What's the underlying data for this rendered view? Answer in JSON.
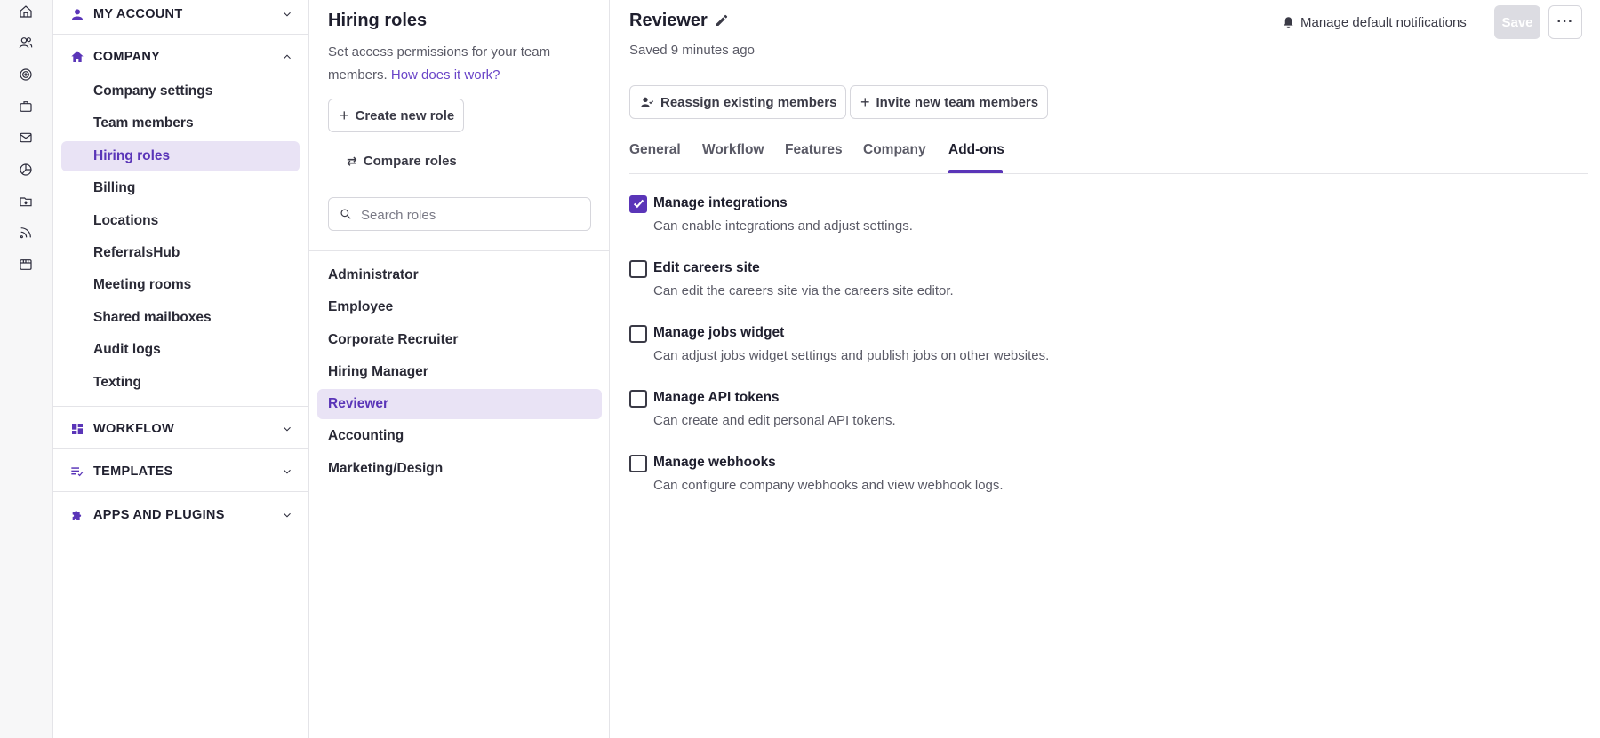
{
  "rail": {
    "icons": [
      "home-icon",
      "people-icon",
      "target-icon",
      "briefcase-icon",
      "mail-icon",
      "pie-chart-icon",
      "folder-icon",
      "rss-icon",
      "store-icon"
    ]
  },
  "nav": {
    "my_account": "MY ACCOUNT",
    "company": "COMPANY",
    "company_items": [
      {
        "label": "Company settings"
      },
      {
        "label": "Team members"
      },
      {
        "label": "Hiring roles"
      },
      {
        "label": "Billing"
      },
      {
        "label": "Locations"
      },
      {
        "label": "ReferralsHub"
      },
      {
        "label": "Meeting rooms"
      },
      {
        "label": "Shared mailboxes"
      },
      {
        "label": "Audit logs"
      },
      {
        "label": "Texting"
      }
    ],
    "active_item": "Hiring roles",
    "workflow": "WORKFLOW",
    "templates": "TEMPLATES",
    "apps": "APPS AND PLUGINS"
  },
  "roles_panel": {
    "title": "Hiring roles",
    "description": "Set access permissions for your team members.",
    "help_link": "How does it work?",
    "create_button": "Create new role",
    "compare_button": "Compare roles",
    "search_placeholder": "Search roles",
    "roles": [
      {
        "label": "Administrator"
      },
      {
        "label": "Employee"
      },
      {
        "label": "Corporate Recruiter"
      },
      {
        "label": "Hiring Manager"
      },
      {
        "label": "Reviewer"
      },
      {
        "label": "Accounting"
      },
      {
        "label": "Marketing/Design"
      }
    ],
    "active_role": "Reviewer"
  },
  "main": {
    "role_name": "Reviewer",
    "saved_status": "Saved 9 minutes ago",
    "notifications_button": "Manage default notifications",
    "save_button": "Save",
    "more_button": "···",
    "reassign_button": "Reassign existing members",
    "invite_button": "Invite new team members",
    "tabs": [
      {
        "label": "General"
      },
      {
        "label": "Workflow"
      },
      {
        "label": "Features"
      },
      {
        "label": "Company"
      },
      {
        "label": "Add-ons"
      }
    ],
    "active_tab": "Add-ons",
    "permissions": [
      {
        "title": "Manage integrations",
        "description": "Can enable integrations and adjust settings.",
        "checked": true
      },
      {
        "title": "Edit careers site",
        "description": "Can edit the careers site via the careers site editor.",
        "checked": false
      },
      {
        "title": "Manage jobs widget",
        "description": "Can adjust jobs widget settings and publish jobs on other websites.",
        "checked": false
      },
      {
        "title": "Manage API tokens",
        "description": "Can create and edit personal API tokens.",
        "checked": false
      },
      {
        "title": "Manage webhooks",
        "description": "Can configure company webhooks and view webhook logs.",
        "checked": false
      }
    ]
  },
  "colors": {
    "accent": "#5a35b8",
    "active_bg": "#e9e3f5",
    "link": "#6a45c8"
  }
}
